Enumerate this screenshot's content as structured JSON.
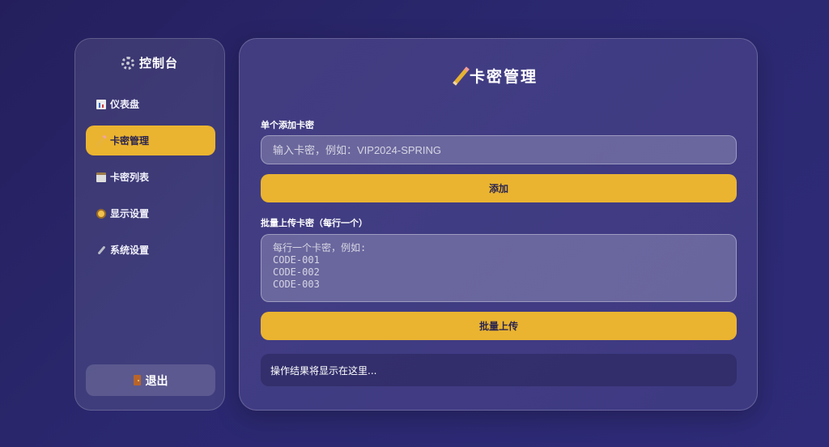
{
  "sidebar": {
    "title": "控制台",
    "items": [
      {
        "label": "仪表盘",
        "icon": "bar-chart-icon"
      },
      {
        "label": "卡密管理",
        "icon": "pencil-icon",
        "active": true
      },
      {
        "label": "卡密列表",
        "icon": "clipboard-icon"
      },
      {
        "label": "显示设置",
        "icon": "eye-icon"
      },
      {
        "label": "系统设置",
        "icon": "wrench-icon"
      }
    ],
    "logout_label": "退出"
  },
  "main": {
    "title": "卡密管理",
    "single_add": {
      "label": "单个添加卡密",
      "placeholder": "输入卡密，例如：VIP2024-SPRING",
      "value": "",
      "button_label": "添加"
    },
    "batch_upload": {
      "label": "批量上传卡密（每行一个）",
      "placeholder": "每行一个卡密，例如:\nCODE-001\nCODE-002\nCODE-003",
      "value": "",
      "button_label": "批量上传"
    },
    "result_text": "操作结果将显示在这里..."
  },
  "colors": {
    "accent": "#eab431",
    "background": "#2b2870"
  }
}
